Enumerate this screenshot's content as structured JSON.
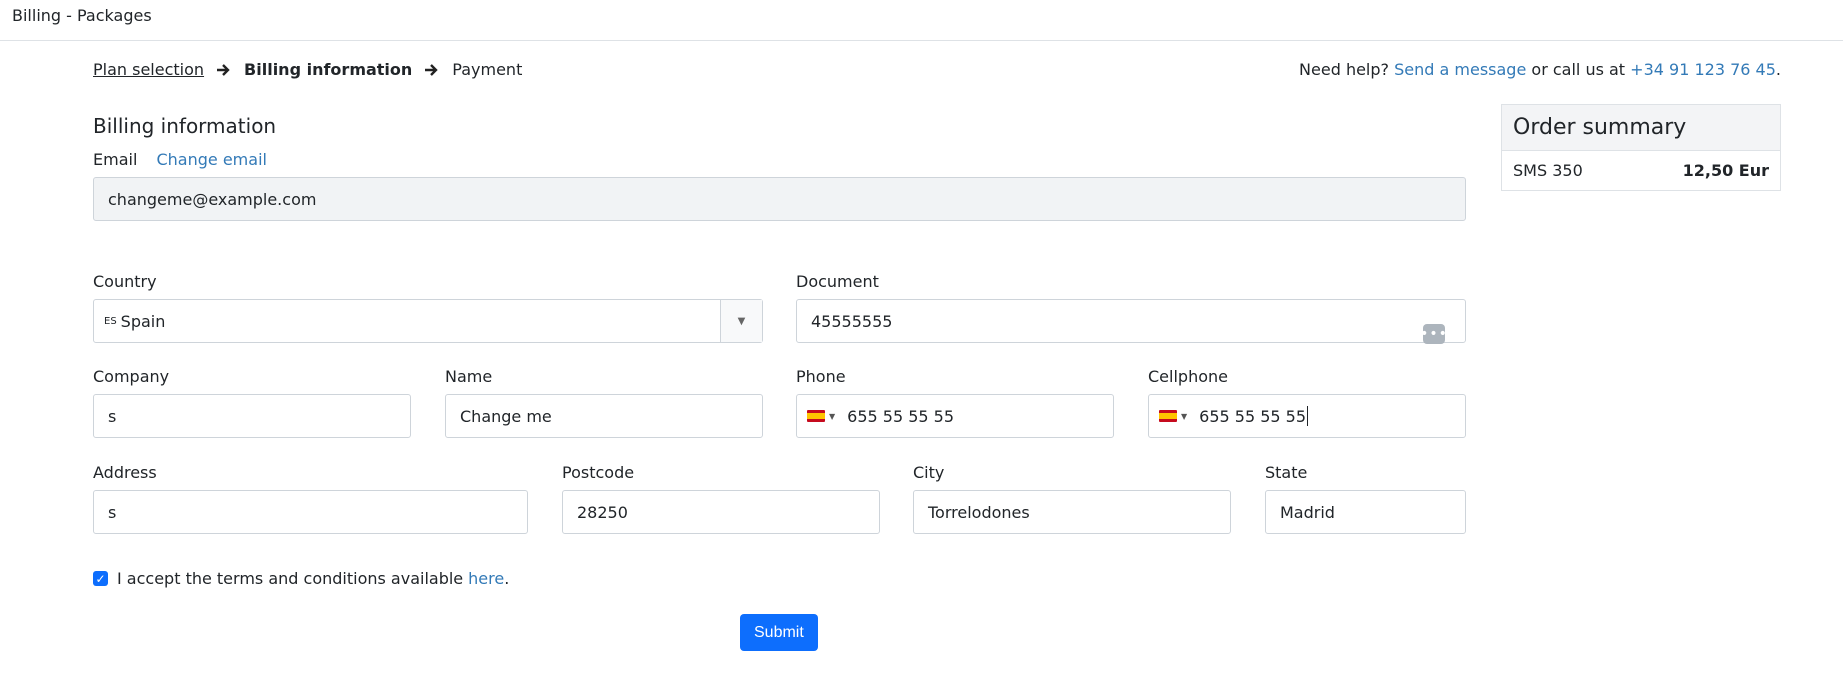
{
  "app": {
    "title": "Billing - Packages"
  },
  "breadcrumb": {
    "step1": "Plan selection",
    "step2": "Billing information",
    "step3": "Payment"
  },
  "help": {
    "prefix": "Need help?",
    "message_link": "Send a message",
    "middle": "or call us at",
    "phone_link": "+34 91 123 76 45",
    "suffix": "."
  },
  "form": {
    "title": "Billing information",
    "email_label": "Email",
    "change_email": "Change email",
    "email_value": "changeme@example.com",
    "country_label": "Country",
    "country_code": "ES",
    "country_value": "Spain",
    "document_label": "Document",
    "document_value": "45555555",
    "company_label": "Company",
    "company_value": "s",
    "name_label": "Name",
    "name_value": "Change me",
    "phone_label": "Phone",
    "phone_value": "655 55 55 55",
    "cellphone_label": "Cellphone",
    "cellphone_value": "655 55 55 55",
    "address_label": "Address",
    "address_value": "s",
    "postcode_label": "Postcode",
    "postcode_value": "28250",
    "city_label": "City",
    "city_value": "Torrelodones",
    "state_label": "State",
    "state_value": "Madrid",
    "terms_text": "I accept the terms and conditions available",
    "terms_link": "here",
    "terms_suffix": ".",
    "submit": "Submit"
  },
  "summary": {
    "title": "Order summary",
    "item": "SMS 350",
    "price": "12,50 Eur"
  },
  "colors": {
    "primary": "#0d6efd",
    "link": "#337ab7"
  }
}
